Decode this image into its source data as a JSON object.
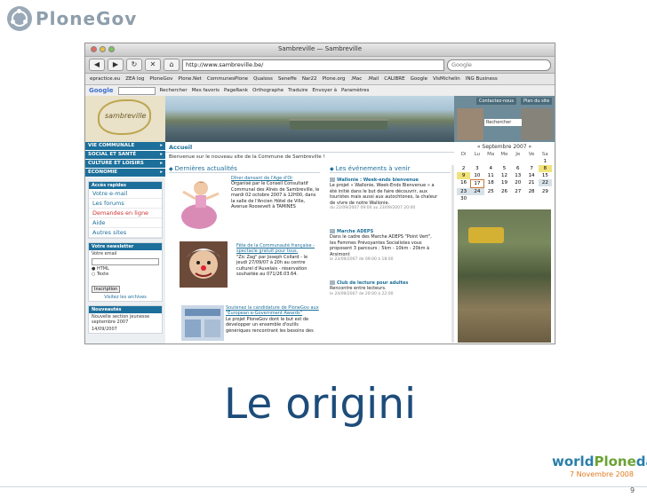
{
  "brand": {
    "name": "PloneGov"
  },
  "browser": {
    "window_title": "Sambreville — Sambreville",
    "url": "http://www.sambreville.be/",
    "search_placeholder": "Google",
    "bookmarks": [
      "epractice.eu",
      "ZEA log",
      "PloneGov",
      "Plone.Net",
      "CommunesPlone",
      "Qualoss",
      "Seneffe",
      "Nar22",
      "Plone.org",
      ".Mac",
      ".Mail",
      "CALIBRE",
      "Google",
      "VisMichelin",
      "ING Business"
    ],
    "google_toolbar": [
      "Google",
      "Rechercher",
      "Mes favoris",
      "PageRank",
      "Orthographe",
      "Traduire",
      "Envoyer à",
      "Paramètres"
    ]
  },
  "site": {
    "banner_logo_text": "sambreville",
    "banner_buttons": [
      "Contactez-nous",
      "Plan du site"
    ],
    "banner_search": "Rechercher",
    "menu": [
      "VIE COMMUNALE",
      "SOCIAL ET SANTÉ",
      "CULTURE ET LOISIRS",
      "ECONOMIE"
    ],
    "quick_access": {
      "title": "Accès rapides",
      "items": [
        "Votre e-mail",
        "Les forums",
        "Demandes en ligne",
        "Aide",
        "Autres sites"
      ]
    },
    "newsletter": {
      "title": "Votre newsletter",
      "email_label": "Votre email",
      "options": [
        "HTML",
        "Texte"
      ],
      "button": "Inscription",
      "archives_link": "Visitez les archives"
    },
    "news_box": {
      "title": "Nouveautés",
      "items": [
        "Nouvelle section jeunesse septembre 2007",
        "14/09/2007"
      ]
    },
    "breadcrumb": "Accueil",
    "welcome": "Bienvenue sur le nouveau site de la Commune de Sambreville !",
    "latest_news_heading": "Dernières actualités",
    "events_heading": "Les événements à venir",
    "news": [
      {
        "title": "Dîner dansant de l'Age d'Or",
        "lines": [
          "Organisé par le Conseil Consultatif",
          "Communal des Aînés de Sambreville, le",
          "mardi 02 octobre 2007 à 12H00, dans",
          "la salle de l'Ancien Hôtel de Ville,",
          "Avenue Roosevelt à TAMINES"
        ]
      },
      {
        "title": "Fête de la Communauté française - spectacle gratuit pour tous.",
        "lines": [
          "\"Zic Zag\" par Joseph Collard - le",
          "jeudi 27/09/07 à 20h au centre",
          "culturel d'Auvelais - réservation",
          "souhaitée au 071/26.03.64."
        ]
      },
      {
        "title": "Soutenez la candidature de PloneGov aux \"European e-Government Awards\"",
        "lines": [
          "Le projet PloneGov dont le but est de",
          "développer un ensemble d'outils",
          "génériques rencontrant les besoins des"
        ]
      }
    ],
    "events": [
      {
        "title": "Wallonie : Week-ends bienvenue",
        "lines": [
          "Le projet « Wallonie, Week-Ends Bienvenue » a",
          "été initié dans le but de faire découvrir, aux",
          "touristes mais aussi aux autochtones, la chaleur",
          "de vivre de notre Wallonie."
        ],
        "date": "du 22/09/2007 09:00 au 23/09/2007 20:00"
      },
      {
        "title": "Marche ADEPS",
        "lines": [
          "Dans le cadre des Marche ADEPS \"Point Vert\",",
          "les Femmes Prévoyantes Socialistes vous",
          "proposent 3 parcours : 5km - 10km - 20km à",
          "Arsimont"
        ],
        "date": "le 23/09/2007 de 09:00 à 18:00"
      },
      {
        "title": "Club de lecture pour adultes",
        "lines": [
          "Rencontre entre lecteurs."
        ],
        "date": "le 24/09/2007 de 20:00 à 22:00"
      }
    ],
    "calendar": {
      "title": "Septembre 2007",
      "headers": [
        "Di",
        "Lu",
        "Ma",
        "Me",
        "Je",
        "Ve",
        "Sa"
      ],
      "days": [
        "",
        "",
        "",
        "",
        "",
        "",
        "1",
        "2",
        "3",
        "4",
        "5",
        "6",
        "7",
        "8",
        "9",
        "10",
        "11",
        "12",
        "13",
        "14",
        "15",
        "16",
        "17",
        "18",
        "19",
        "20",
        "21",
        "22",
        "23",
        "24",
        "25",
        "26",
        "27",
        "28",
        "29",
        "30"
      ]
    }
  },
  "slide": {
    "title": "Le origini",
    "event_name_parts": [
      "world",
      "Plone",
      "day"
    ],
    "event_date": "7 Novembre 2008",
    "page_number": "9"
  },
  "colors": {
    "title": "#1d4c7a",
    "brand": "#8e9eab",
    "site_accent": "#1c6f9a",
    "event_date": "#e07a1f"
  }
}
